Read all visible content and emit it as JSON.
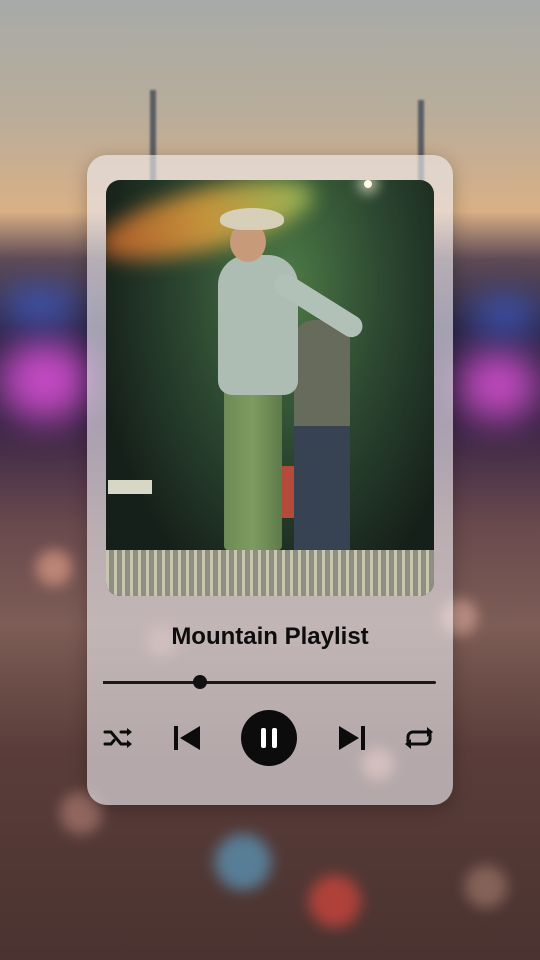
{
  "player": {
    "title": "Mountain Playlist",
    "progress": 0.29,
    "is_playing": true
  },
  "controls": {
    "shuffle_icon": "shuffle-icon",
    "previous_icon": "skip-previous-icon",
    "play_pause_icon": "pause-icon",
    "next_icon": "skip-next-icon",
    "repeat_icon": "repeat-icon"
  },
  "colors": {
    "card": "#eeecf0",
    "icon": "#0c0c0c",
    "title": "#0d0d0d"
  }
}
